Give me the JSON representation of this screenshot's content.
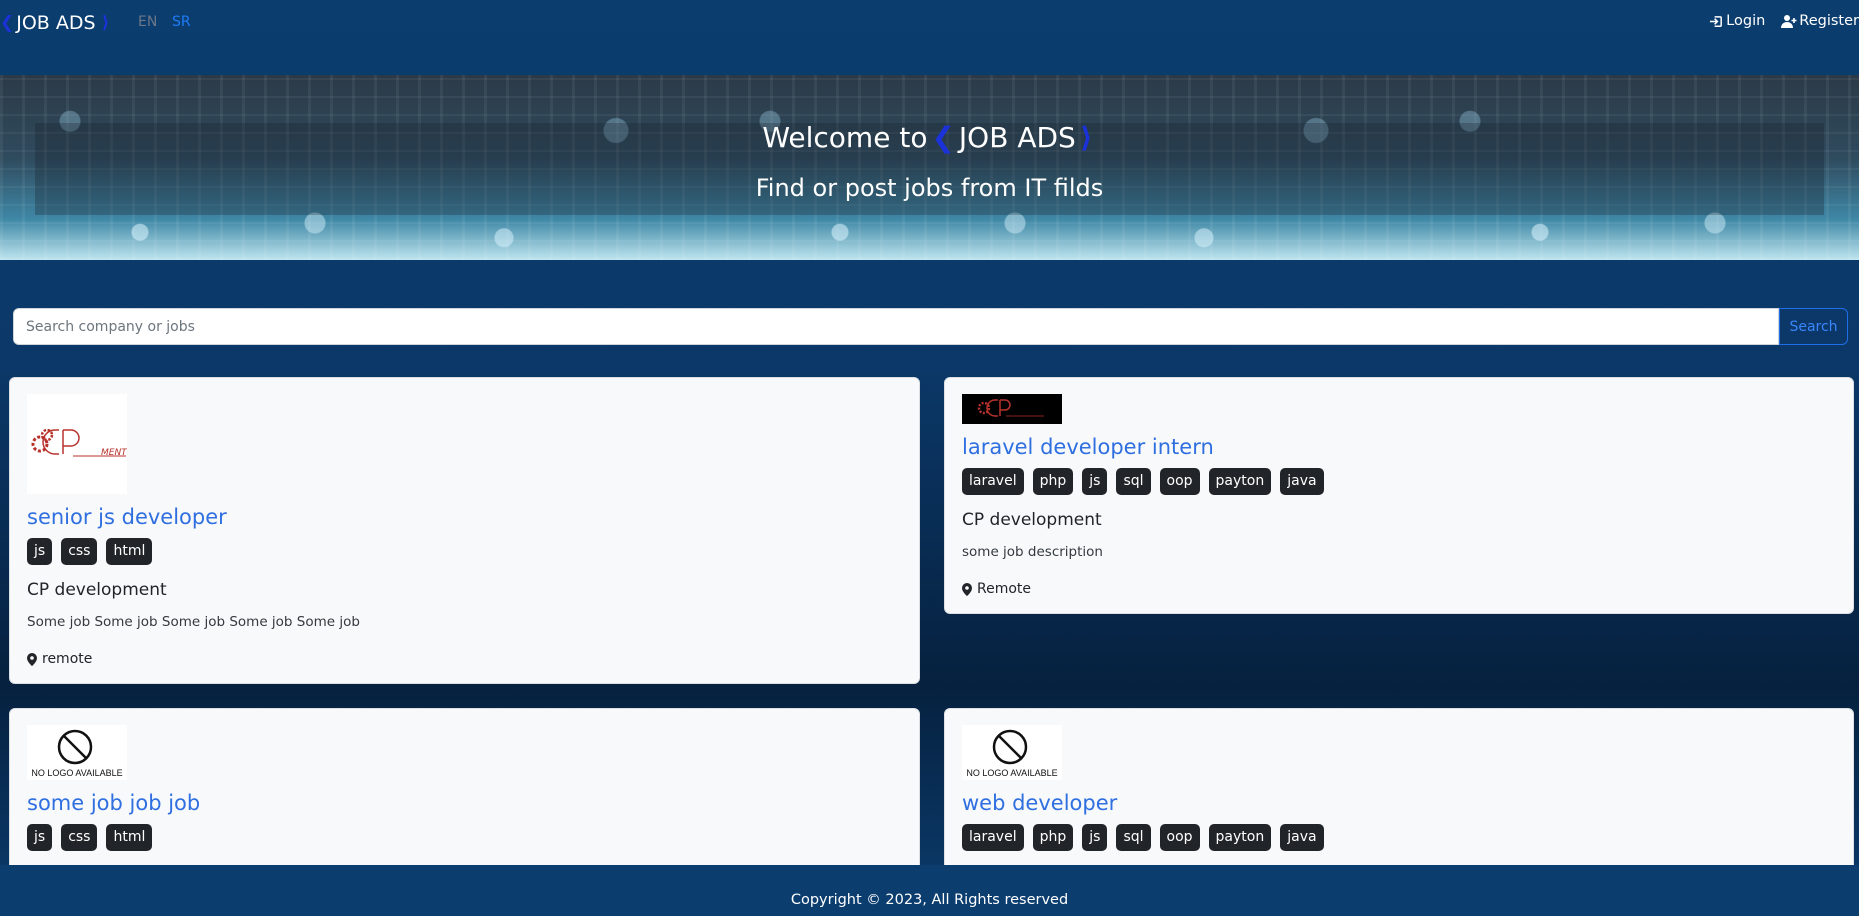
{
  "navbar": {
    "brand": "JOB ADS",
    "brand_left_bracket": "❮",
    "brand_right_bracket": "⟩",
    "lang_en": "EN",
    "lang_sr": "SR",
    "login": "Login",
    "register": "Register"
  },
  "hero": {
    "title_prefix": "Welcome to",
    "title_brand": "JOB ADS",
    "left_bracket": "❮",
    "right_bracket": "⟩",
    "subtitle": "Find or post jobs from IT filds"
  },
  "search": {
    "placeholder": "Search company or jobs",
    "button": "Search"
  },
  "jobs": [
    {
      "title": "senior js developer",
      "tags": [
        "js",
        "css",
        "html"
      ],
      "company": "CP development",
      "description": "Some job Some job Some job Some job Some job",
      "location": "remote",
      "logo_text": "MENT"
    },
    {
      "title": "laravel developer intern",
      "tags": [
        "laravel",
        "php",
        "js",
        "sql",
        "oop",
        "payton",
        "java"
      ],
      "company": "CP development",
      "description": "some job description",
      "location": "Remote"
    },
    {
      "title": "some job job job",
      "tags": [
        "js",
        "css",
        "html"
      ],
      "logo_text": "NO LOGO AVAILABLE"
    },
    {
      "title": "web developer",
      "tags": [
        "laravel",
        "php",
        "js",
        "sql",
        "oop",
        "payton",
        "java"
      ],
      "logo_text": "NO LOGO AVAILABLE"
    }
  ],
  "footer": {
    "copyright": "Copyright © 2023, All Rights reserved"
  },
  "colors": {
    "navbar_bg": "#0b3d6f",
    "accent_bracket": "#1b32d9",
    "link": "#2f6fe0",
    "tag_bg": "#212529"
  }
}
